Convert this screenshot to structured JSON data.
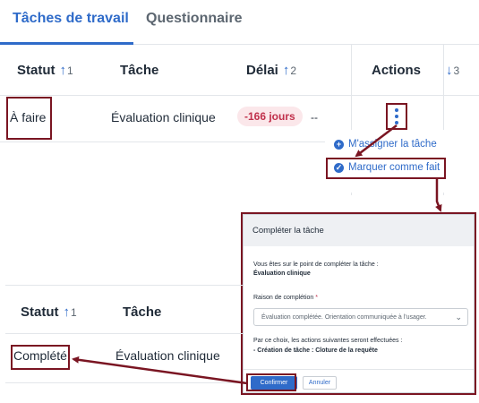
{
  "tabs": [
    {
      "label": "Tâches de travail"
    },
    {
      "label": "Questionnaire"
    }
  ],
  "top_table": {
    "headers": {
      "statut": "Statut",
      "statut_sort": "1",
      "tache": "Tâche",
      "delai": "Délai",
      "delai_sort": "2",
      "actions": "Actions",
      "extra_sort": "3"
    },
    "row": {
      "statut": "À faire",
      "tache": "Évaluation clinique",
      "delai": "-166 jours",
      "extra": "--"
    }
  },
  "menu": {
    "assign": "M'assigner la tâche",
    "mark_done": "Marquer comme fait"
  },
  "modal": {
    "title": "Compléter la tâche",
    "intro": "Vous êtes sur le point de compléter la tâche :",
    "task_name": "Évaluation clinique",
    "reason_label": "Raison de complétion",
    "reason_required": "*",
    "reason_value": "Évaluation complétée. Orientation communiquée à l'usager.",
    "consequence": "Par ce choix, les actions suivantes seront effectuées :",
    "actions_line": "- Création de tâche : Cloture de la requête",
    "confirm": "Confirmer",
    "cancel": "Annuler"
  },
  "bottom_table": {
    "headers": {
      "statut": "Statut",
      "statut_sort": "1",
      "tache": "Tâche"
    },
    "row": {
      "statut": "Complété",
      "tache": "Évaluation clinique"
    }
  },
  "colors": {
    "accent": "#2f6bc9",
    "highlight": "#7a1522",
    "danger_bg": "#fbe7ea",
    "danger_text": "#c0304b"
  }
}
